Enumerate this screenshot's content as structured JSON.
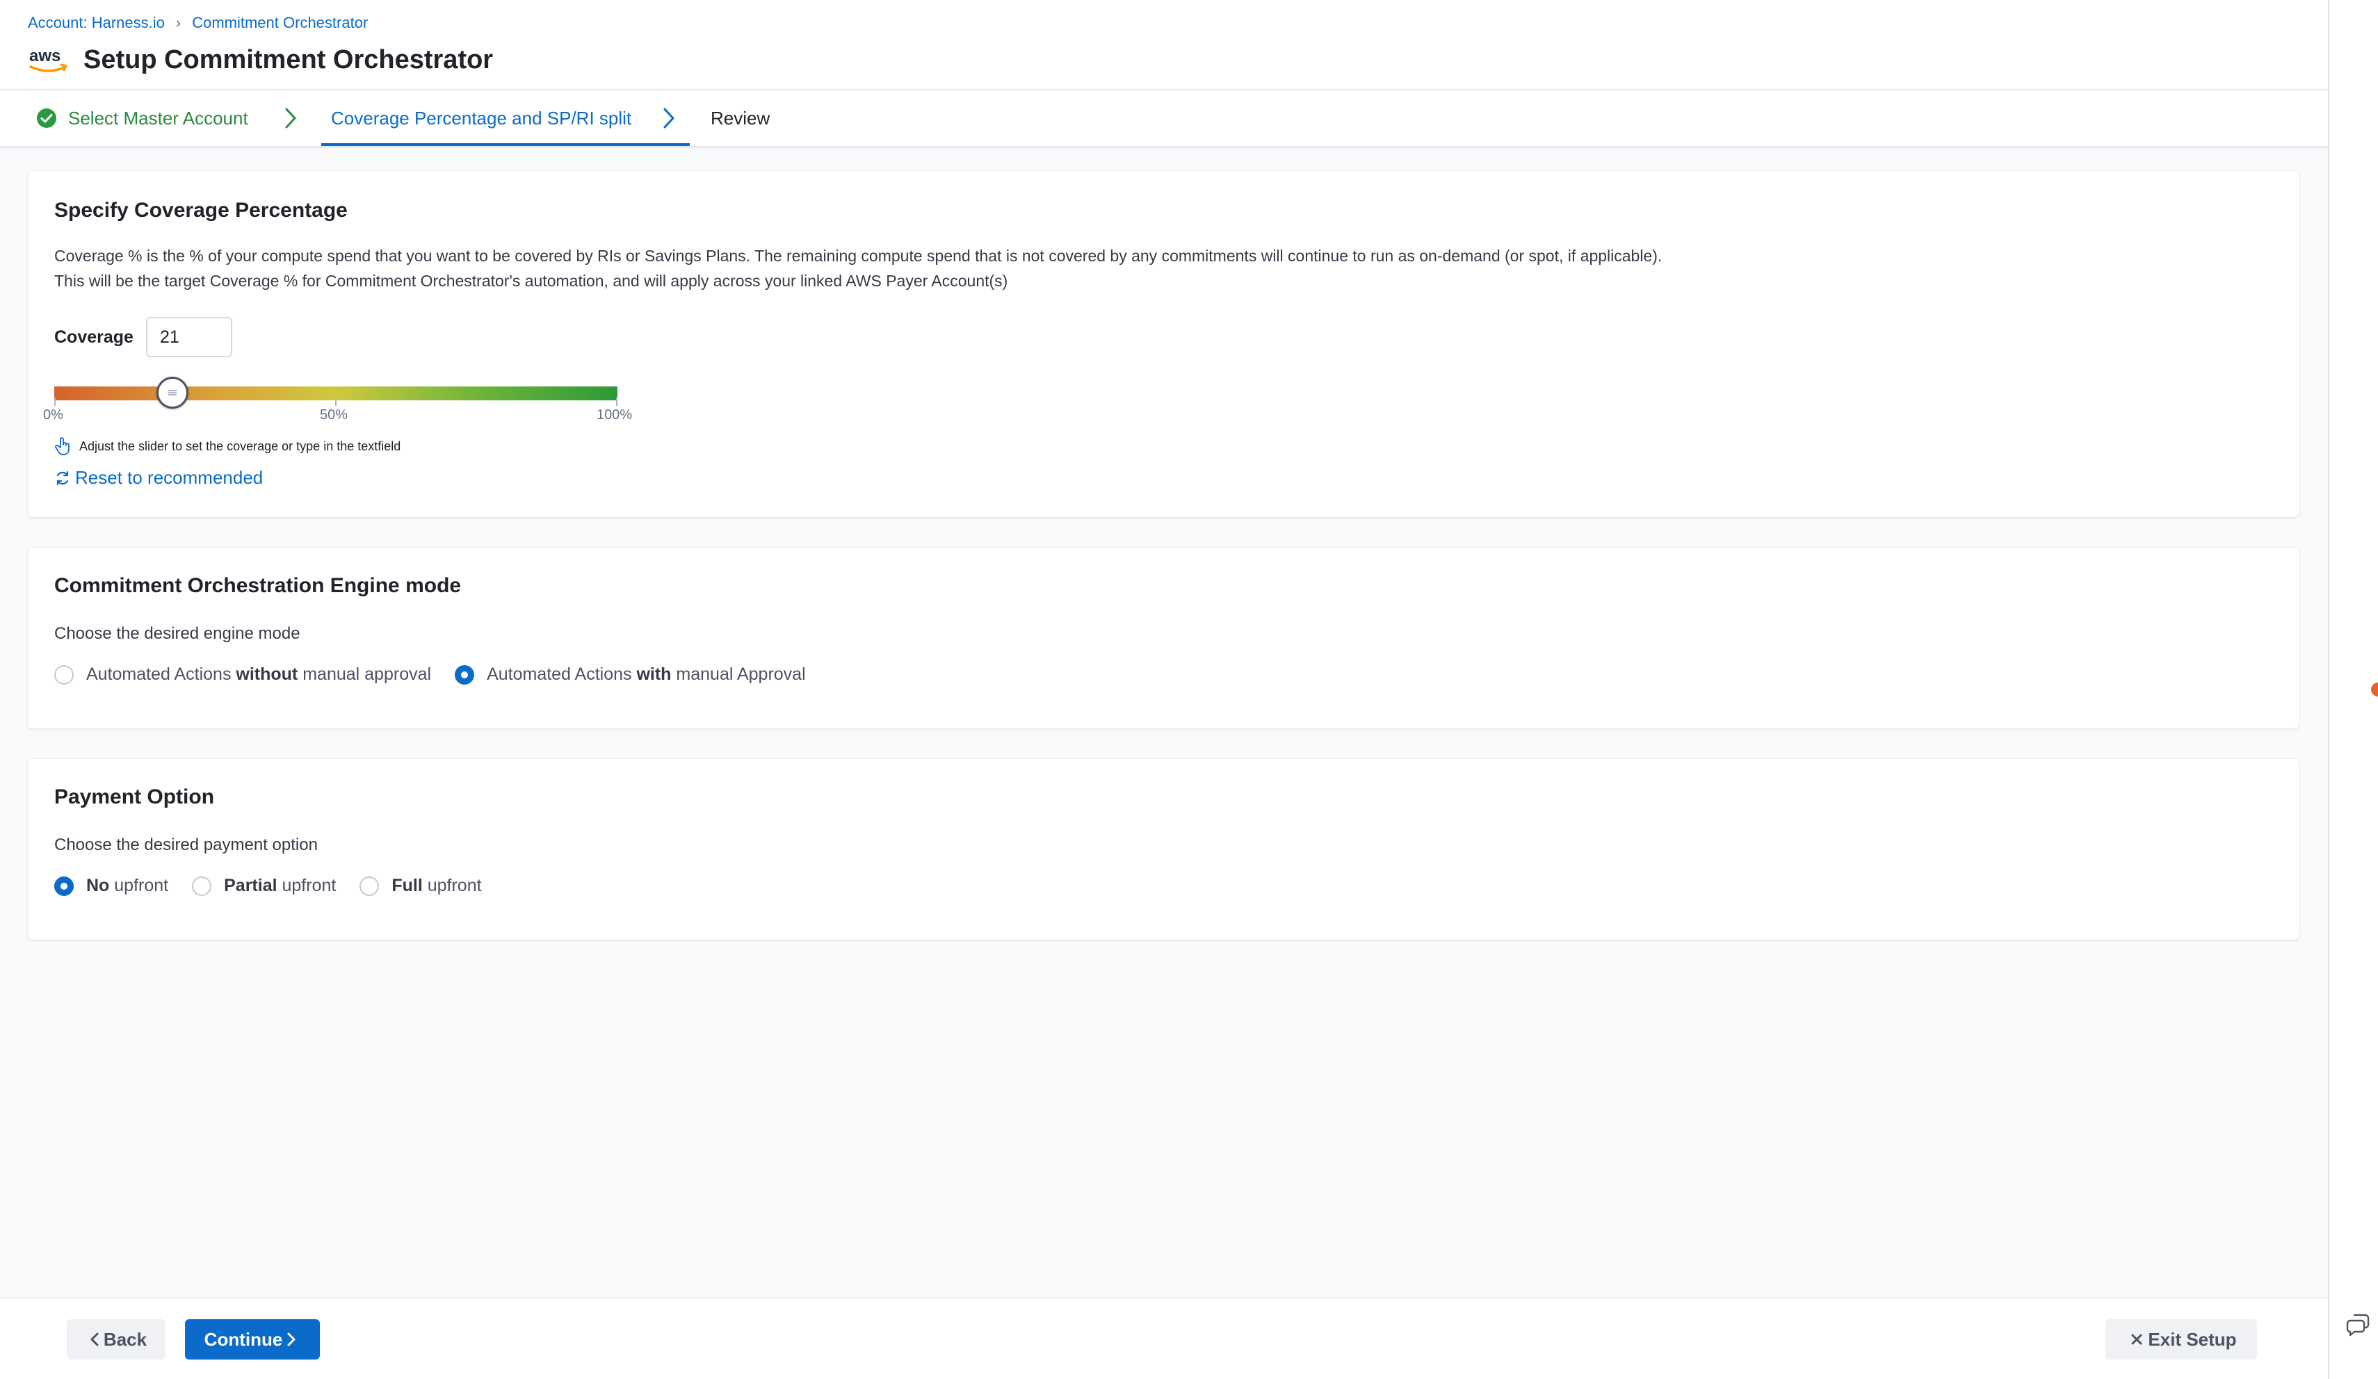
{
  "breadcrumb": {
    "account": "Account: Harness.io",
    "current": "Commitment Orchestrator"
  },
  "header": {
    "logo_icon": "aws-logo-icon",
    "title": "Setup Commitment Orchestrator"
  },
  "stepper": {
    "steps": [
      {
        "label": "Select Master Account",
        "status": "completed"
      },
      {
        "label": "Coverage Percentage and SP/RI split",
        "status": "active"
      },
      {
        "label": "Review",
        "status": "upcoming"
      }
    ]
  },
  "coverage_card": {
    "title": "Specify Coverage Percentage",
    "desc_line1": "Coverage % is the % of your compute spend that you want to be covered by RIs or Savings Plans. The remaining compute spend that is not covered by any commitments will continue to run as on-demand (or spot, if applicable).",
    "desc_line2": "This will be the target Coverage % for Commitment Orchestrator's automation, and will apply across your linked AWS Payer Account(s)",
    "coverage_label": "Coverage",
    "coverage_value": "21",
    "slider_value_percent": 21,
    "tick_labels": [
      "0%",
      "50%",
      "100%"
    ],
    "hint": "Adjust the slider to set the coverage or type in the textfield",
    "reset_label": "Reset to recommended"
  },
  "engine_card": {
    "title": "Commitment Orchestration Engine mode",
    "subtitle": "Choose the desired engine mode",
    "options": [
      {
        "prefix": "Automated Actions ",
        "bold": "without",
        "suffix": " manual approval",
        "selected": false
      },
      {
        "prefix": "Automated Actions ",
        "bold": "with",
        "suffix": " manual Approval",
        "selected": true
      }
    ]
  },
  "payment_card": {
    "title": "Payment Option",
    "subtitle": "Choose the desired payment option",
    "options": [
      {
        "bold": "No",
        "suffix": " upfront",
        "selected": true
      },
      {
        "bold": "Partial",
        "suffix": " upfront",
        "selected": false
      },
      {
        "bold": "Full",
        "suffix": " upfront",
        "selected": false
      }
    ]
  },
  "footer": {
    "back_label": "Back",
    "continue_label": "Continue",
    "exit_label": "Exit Setup"
  },
  "colors": {
    "accent": "#0b6bcb",
    "success": "#2a8a3f",
    "notification_dot": "#e8632b"
  }
}
